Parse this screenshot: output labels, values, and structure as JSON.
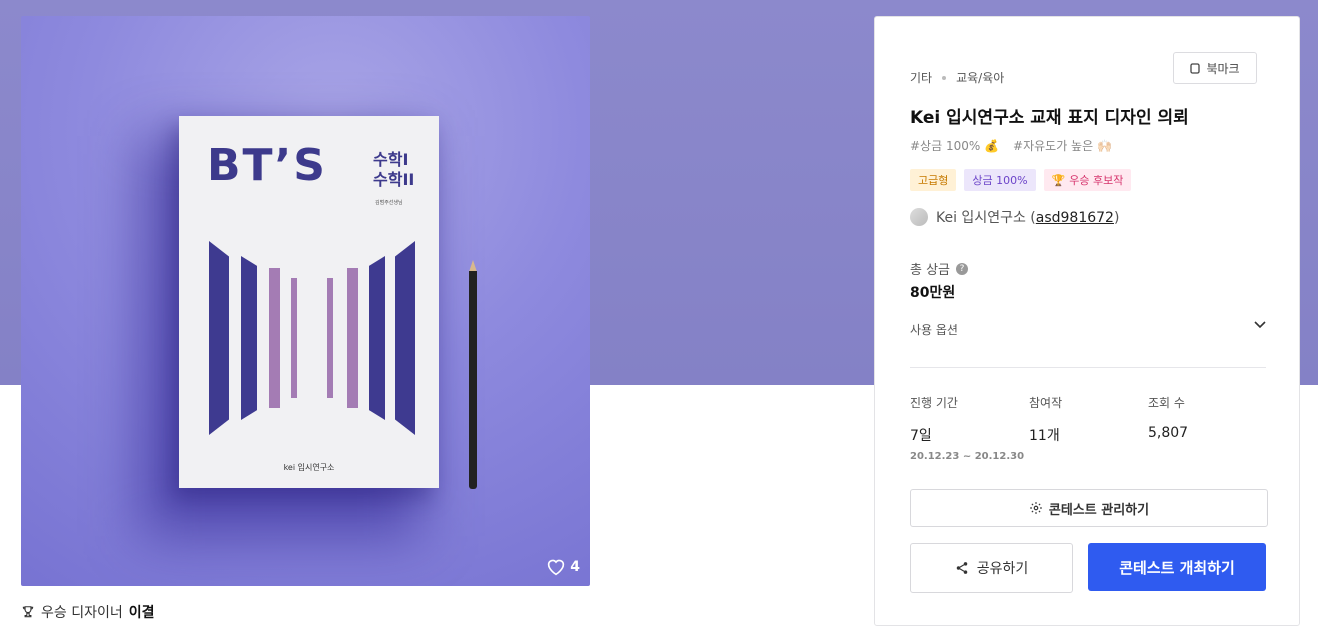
{
  "image": {
    "book_title": "BT’S",
    "book_subject_1": "수학I",
    "book_subject_2": "수학II",
    "book_author": "김범주선생님",
    "book_publisher": "kei 입시연구소",
    "likes": "4"
  },
  "winner": {
    "label": "우승 디자이너",
    "name": "이결"
  },
  "panel": {
    "category_1": "기타",
    "category_2": "교육/육아",
    "bookmark_label": "북마크",
    "title": "Kei 입시연구소 교재 표지 디자인 의뢰",
    "tags": [
      "#상금 100% 💰",
      "#자유도가 높은 🙌🏻"
    ],
    "badges": [
      "고급형",
      "상금 100%",
      "우승 후보작"
    ],
    "host_name": "Kei 입시연구소 (",
    "host_id": "asd981672",
    "host_close": ")",
    "prize_label": "총 상금",
    "prize_value": "80만원",
    "options_label": "사용 옵션",
    "stats": {
      "period_label": "진행 기간",
      "period_value": "7일",
      "period_range": "20.12.23 ~ 20.12.30",
      "entries_label": "참여작",
      "entries_value": "11개",
      "views_label": "조회 수",
      "views_value": "5,807"
    },
    "manage_label": "콘테스트 관리하기",
    "share_label": "공유하기",
    "host_button_label": "콘테스트 개최하기"
  },
  "colors": {
    "hero_bg": "#8c89cc",
    "primary_button": "#2f5bf0"
  }
}
